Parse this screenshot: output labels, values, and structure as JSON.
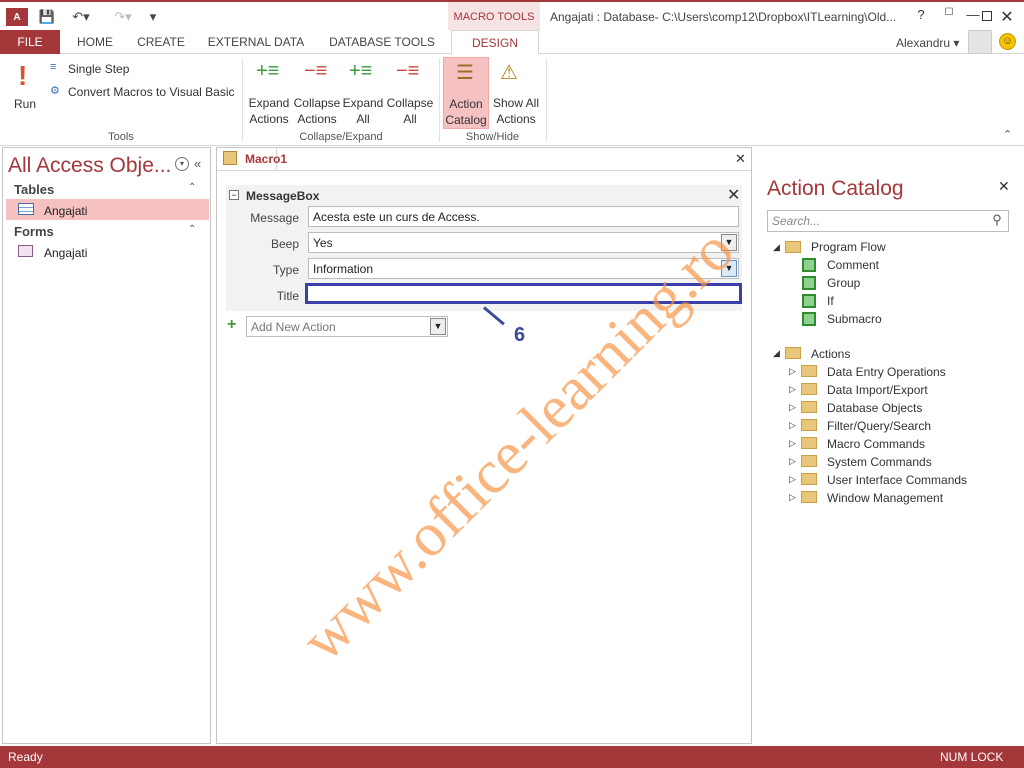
{
  "titlebar": {
    "context_tab": "MACRO TOOLS",
    "window_title": "Angajati : Database- C:\\Users\\comp12\\Dropbox\\ITLearning\\Old...",
    "help": "?"
  },
  "tabs": [
    "FILE",
    "HOME",
    "CREATE",
    "EXTERNAL DATA",
    "DATABASE TOOLS",
    "DESIGN"
  ],
  "user": {
    "name": "Alexandru"
  },
  "ribbon": {
    "run": "Run",
    "single_step": "Single Step",
    "convert": "Convert Macros to Visual Basic",
    "tools_group": "Tools",
    "expand_actions": [
      "Expand",
      "Actions"
    ],
    "collapse_actions": [
      "Collapse",
      "Actions"
    ],
    "expand_all": [
      "Expand",
      "All"
    ],
    "collapse_all": [
      "Collapse",
      "All"
    ],
    "collapse_expand_group": "Collapse/Expand",
    "action_catalog": [
      "Action",
      "Catalog"
    ],
    "show_all_actions": [
      "Show All",
      "Actions"
    ],
    "show_hide_group": "Show/Hide"
  },
  "nav": {
    "title": "All Access Obje...",
    "tables_header": "Tables",
    "table_item": "Angajati",
    "forms_header": "Forms",
    "form_item": "Angajati"
  },
  "doc": {
    "tab": "Macro1",
    "action_name": "MessageBox",
    "message_label": "Message",
    "message_value": "Acesta este un curs de Access.",
    "beep_label": "Beep",
    "beep_value": "Yes",
    "type_label": "Type",
    "type_value": "Information",
    "title_label": "Title",
    "title_value": "",
    "add_new_action": "Add New Action",
    "annotation": "6"
  },
  "catalog": {
    "title": "Action Catalog",
    "search_placeholder": "Search...",
    "program_flow": "Program Flow",
    "program_flow_items": [
      "Comment",
      "Group",
      "If",
      "Submacro"
    ],
    "actions": "Actions",
    "action_folders": [
      "Data Entry Operations",
      "Data Import/Export",
      "Database Objects",
      "Filter/Query/Search",
      "Macro Commands",
      "System Commands",
      "User Interface Commands",
      "Window Management"
    ]
  },
  "status": {
    "left": "Ready",
    "right": "NUM LOCK"
  },
  "watermark": "www.office-learning.ro",
  "colors": {
    "accent": "#a4373a",
    "annotation": "#3b3faa",
    "watermark": "#f79646"
  }
}
